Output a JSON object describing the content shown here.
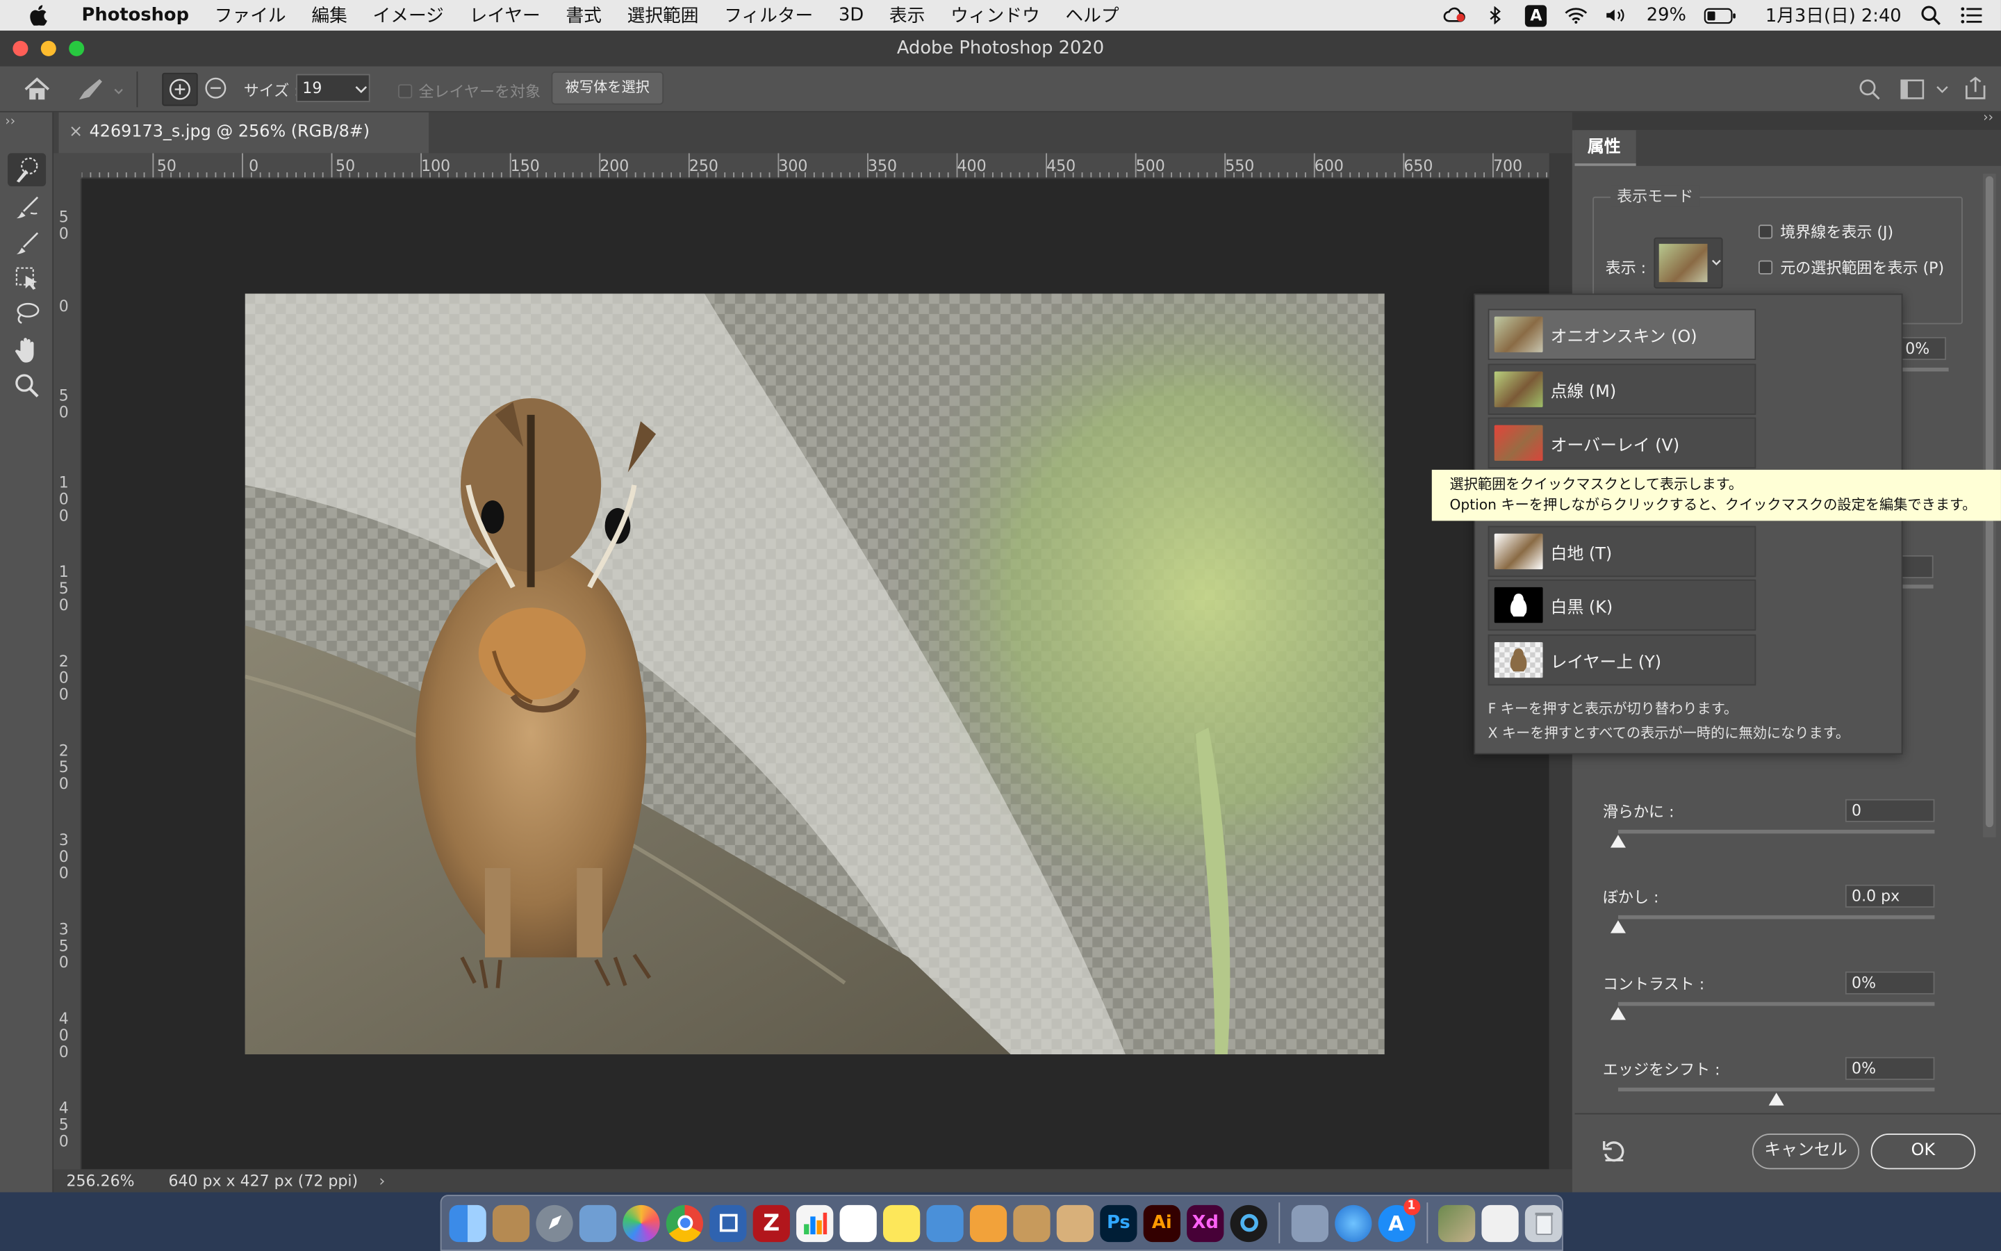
{
  "menubar": {
    "app": "Photoshop",
    "items": [
      "ファイル",
      "編集",
      "イメージ",
      "レイヤー",
      "書式",
      "選択範囲",
      "フィルター",
      "3D",
      "表示",
      "ウィンドウ",
      "ヘルプ"
    ],
    "battery": "29%",
    "clock": "1月3日(日)  2:40",
    "input_mode": "A"
  },
  "window": {
    "title": "Adobe Photoshop 2020"
  },
  "options": {
    "size_label": "サイズ :",
    "size_value": "19",
    "all_layers_label": "全レイヤーを対象",
    "select_subject_label": "被写体を選択"
  },
  "document": {
    "tab_title": "4269173_s.jpg @ 256% (RGB/8#)",
    "zoom": "256.26%",
    "dimensions": "640 px x 427 px (72 ppi)"
  },
  "ruler": {
    "h": [
      "50",
      "0",
      "50",
      "100",
      "150",
      "200",
      "250",
      "300",
      "350",
      "400",
      "450",
      "500",
      "550",
      "600",
      "650",
      "700"
    ],
    "v": [
      "5 0",
      "0",
      "5 0",
      "1 0 0",
      "1 5 0",
      "2 0 0",
      "2 5 0",
      "3 0 0",
      "3 5 0",
      "4 0 0",
      "4 5 0"
    ]
  },
  "properties": {
    "tab": "属性",
    "view_mode_label": "表示モード",
    "display_label": "表示 :",
    "show_edge_label": "境界線を表示 (J)",
    "show_original_label": "元の選択範囲を表示 (P)",
    "partial_value": "0%",
    "smooth_label": "滑らかに :",
    "smooth_value": "0",
    "smooth_level": 0,
    "feather_label": "ぼかし :",
    "feather_value": "0.0 px",
    "feather_level": 0,
    "contrast_label": "コントラスト :",
    "contrast_value": "0%",
    "contrast_level": 0,
    "shift_edge_label": "エッジをシフト :",
    "shift_edge_value": "0%",
    "shift_edge_level": 0.5,
    "cancel_label": "キャンセル",
    "ok_label": "OK"
  },
  "view_popup": {
    "options": [
      {
        "label": "オニオンスキン (O)",
        "selected": true
      },
      {
        "label": "点線 (M)",
        "selected": false
      },
      {
        "label": "オーバーレイ (V)",
        "selected": false
      },
      {
        "label": "白地 (T)",
        "selected": false
      },
      {
        "label": "白黒 (K)",
        "selected": false
      },
      {
        "label": "レイヤー上 (Y)",
        "selected": false
      }
    ],
    "help1": "F キーを押すと表示が切り替わります。",
    "help2": "X キーを押すとすべての表示が一時的に無効になります。"
  },
  "tooltip": {
    "line1": "選択範囲をクイックマスクとして表示します。",
    "line2": "Option キーを押しながらクリックすると、クイックマスクの設定を編集できます。"
  },
  "dock": {
    "apps": [
      "finder-icon",
      "notes-icon",
      "launchpad-icon",
      "preview-icon",
      "photos-icon",
      "chrome-icon",
      "remote-icon",
      "filezilla-icon",
      "numbers-icon",
      "reminders-icon",
      "stickies-icon",
      "keynote-icon",
      "pages-icon",
      "archive-icon",
      "box-icon",
      "photoshop-icon",
      "illustrator-icon",
      "xd-icon",
      "quicktime-icon",
      "image-capture-icon",
      "network-icon",
      "appstore-icon",
      "gallery-icon",
      "docs-icon",
      "trash-icon"
    ],
    "ps_label": "Ps",
    "ai_label": "Ai",
    "xd_label": "Xd",
    "appstore_badge": "1"
  },
  "colors": {
    "accent": "#c7d5a0",
    "ps_blue": "#31a8ff",
    "ai_orange": "#ff9a00",
    "xd_pink": "#ff61f6"
  }
}
